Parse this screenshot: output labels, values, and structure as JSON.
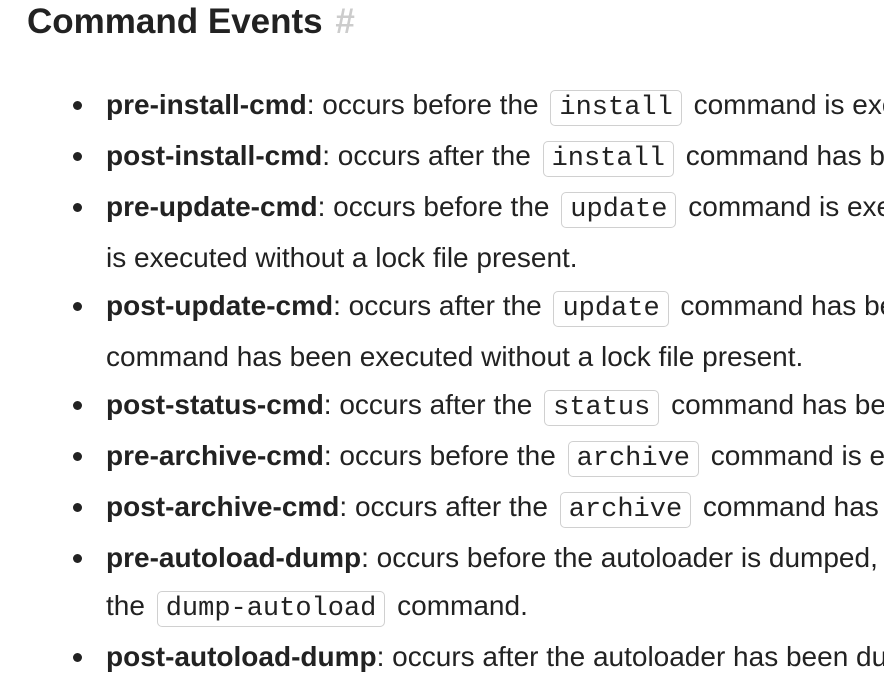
{
  "heading": {
    "title": "Command Events",
    "anchor": "#"
  },
  "events": [
    {
      "name": "pre-install-cmd",
      "text1": ": occurs before the",
      "code": "install",
      "text2": " command is executed with a lock file present.",
      "cont": ""
    },
    {
      "name": "post-install-cmd",
      "text1": ": occurs after the",
      "code": "install",
      "text2": " command has been executed with a lock file present.",
      "cont": ""
    },
    {
      "name": "pre-update-cmd",
      "text1": ": occurs before the",
      "code": "update",
      "text2": " command is executed, or before the install command",
      "cont": "is executed without a lock file present."
    },
    {
      "name": "post-update-cmd",
      "text1": ": occurs after the",
      "code": "update",
      "text2": " command has been executed, or after the install",
      "cont": "command has been executed without a lock file present."
    },
    {
      "name": "post-status-cmd",
      "text1": ": occurs after the",
      "code": "status",
      "text2": " command has been executed.",
      "cont": ""
    },
    {
      "name": "pre-archive-cmd",
      "text1": ": occurs before the",
      "code": "archive",
      "text2": " command is executed.",
      "cont": ""
    },
    {
      "name": "post-archive-cmd",
      "text1": ": occurs after the",
      "code": "archive",
      "text2": " command has been executed.",
      "cont": ""
    },
    {
      "name": "pre-autoload-dump",
      "text1": ": occurs before the autoloader is dumped, either during install/update, or via",
      "code": "",
      "text2": "",
      "cont_pre": "the",
      "cont_code": "dump-autoload",
      "cont_post": " command."
    },
    {
      "name": "post-autoload-dump",
      "text1": ": occurs after the autoloader has been dumped, either during install/update, or via",
      "code": "",
      "text2": "",
      "cont": ""
    }
  ]
}
